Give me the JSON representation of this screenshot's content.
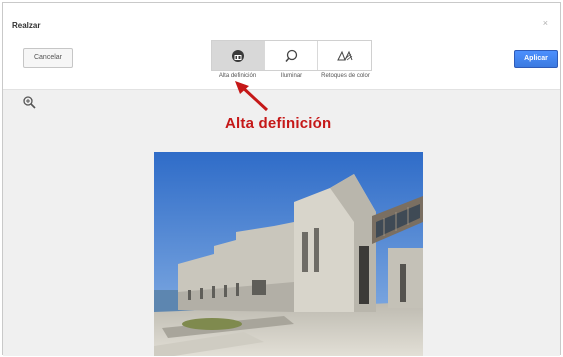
{
  "dialog": {
    "title": "Realzar",
    "close_glyph": "×"
  },
  "actions": {
    "cancel_label": "Cancelar",
    "apply_label": "Aplicar"
  },
  "tools": [
    {
      "label": "Alta definición",
      "icon": "hd-enhance-icon",
      "active": true
    },
    {
      "label": "Iluminar",
      "icon": "illuminate-icon",
      "active": false
    },
    {
      "label": "Retoques de color",
      "icon": "color-retouch-icon",
      "active": false
    }
  ],
  "annotation": {
    "text": "Alta definición",
    "color": "#c51818"
  },
  "zoom": {
    "icon": "zoom-in-icon"
  },
  "colors": {
    "apply_button": "#4d90fe",
    "active_tool_bg": "#d8d8d8",
    "workarea_bg": "#f0f0f0"
  }
}
